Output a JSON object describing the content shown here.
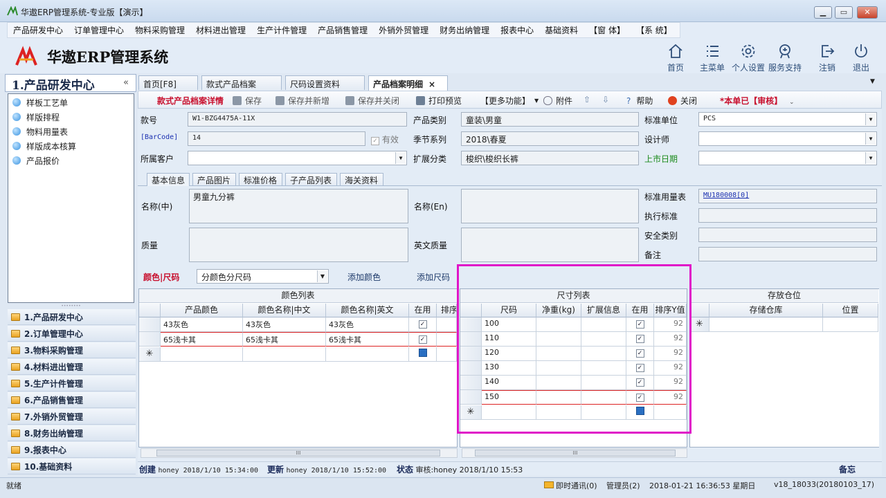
{
  "window": {
    "title": "华遨ERP管理系统-专业版【演示】"
  },
  "menu": [
    "产品研发中心",
    "订单管理中心",
    "物料采购管理",
    "材料进出管理",
    "生产计件管理",
    "产品销售管理",
    "外销外贸管理",
    "财务出纳管理",
    "报表中心",
    "基础资料",
    "【窗 体】",
    "【系 统】"
  ],
  "header": {
    "app_title": "华遨ERP管理系统",
    "buttons": {
      "home": "首页",
      "main_menu": "主菜单",
      "personal": "个人设置",
      "support": "服务支持",
      "logout": "注销",
      "exit": "退出"
    }
  },
  "left": {
    "panel_title": "1.产品研发中心",
    "tree": [
      "样板工艺单",
      "样版排程",
      "物料用量表",
      "样版成本核算",
      "产品报价"
    ],
    "modules": [
      "1.产品研发中心",
      "2.订单管理中心",
      "3.物料采购管理",
      "4.材料进出管理",
      "5.生产计件管理",
      "6.产品销售管理",
      "7.外销外贸管理",
      "8.财务出纳管理",
      "9.报表中心",
      "10.基础资料"
    ]
  },
  "tabs": [
    "首页[F8]",
    "款式产品档案",
    "尺码设置资料",
    "产品档案明细"
  ],
  "toolbar": {
    "detail": "款式产品档案详情",
    "save": "保存",
    "save_new": "保存并新增",
    "save_close": "保存并关闭",
    "print": "打印预览",
    "more": "【更多功能】",
    "attach": "附件",
    "help": "帮助",
    "close": "关闭",
    "status": "*本单已【审核】"
  },
  "form": {
    "style_no_label": "款号",
    "style_no": "W1-BZG4475A-11X",
    "category_label": "产品类别",
    "category": "童装\\男童",
    "unit_label": "标准单位",
    "unit": "PCS",
    "barcode_label": "[BarCode]",
    "barcode": "14",
    "valid_label": "有效",
    "season_label": "季节系列",
    "season": "2018\\春夏",
    "designer_label": "设计师",
    "designer": "",
    "customer_label": "所属客户",
    "customer": "",
    "ext_label": "扩展分类",
    "ext": "梭织\\梭织长裤",
    "launch_label": "上市日期",
    "launch": ""
  },
  "subtabs": [
    "基本信息",
    "产品图片",
    "标准价格",
    "子产品列表",
    "海关资料"
  ],
  "basic": {
    "name_cn_label": "名称(中)",
    "name_cn": "男童九分裤",
    "name_en_label": "名称(En)",
    "name_en": "",
    "quality_label": "质量",
    "quality": "",
    "quality_en_label": "英文质量",
    "quality_en": "",
    "std_usage_label": "标准用量表",
    "std_usage": "MU180008[0]",
    "exec_std_label": "执行标准",
    "exec_std": "",
    "safety_label": "安全类别",
    "safety": "",
    "remark_label": "备注",
    "remark": ""
  },
  "colorsize": {
    "label": "颜色|尺码",
    "mode": "分颜色分尺码",
    "add_color": "添加颜色",
    "add_size": "添加尺码"
  },
  "color_grid": {
    "caption": "颜色列表",
    "headers": [
      "产品颜色",
      "颜色名称|中文",
      "颜色名称|英文",
      "在用",
      "排序"
    ],
    "rows": [
      [
        "43灰色",
        "43灰色",
        "43灰色"
      ],
      [
        "65浅卡其",
        "65浅卡其",
        "65浅卡其"
      ]
    ]
  },
  "size_grid": {
    "caption": "尺寸列表",
    "headers": [
      "尺码",
      "净重(kg)",
      "扩展信息",
      "在用",
      "排序Y值"
    ],
    "rows": [
      "100",
      "110",
      "120",
      "130",
      "140",
      "150"
    ],
    "sort_val": "92"
  },
  "wh_grid": {
    "caption": "存放仓位",
    "headers": [
      "存储仓库",
      "位置"
    ]
  },
  "footer": {
    "created_label": "创建",
    "created": "honey 2018/1/10 15:34:00",
    "updated_label": "更新",
    "updated": "honey 2018/1/10 15:52:00",
    "state_label": "状态",
    "state": "审核:honey 2018/1/10 15:53",
    "memo": "备忘"
  },
  "status": {
    "ready": "就绪",
    "im": "即时通讯(0)",
    "admin": "管理员(2)",
    "datetime": "2018-01-21  16:36:53 星期日",
    "version": "v18_18033(20180103_17)"
  },
  "colors": {
    "accent": "#c8102e",
    "highlight": "#e014c8",
    "nav_blue": "#2f4f7a"
  }
}
